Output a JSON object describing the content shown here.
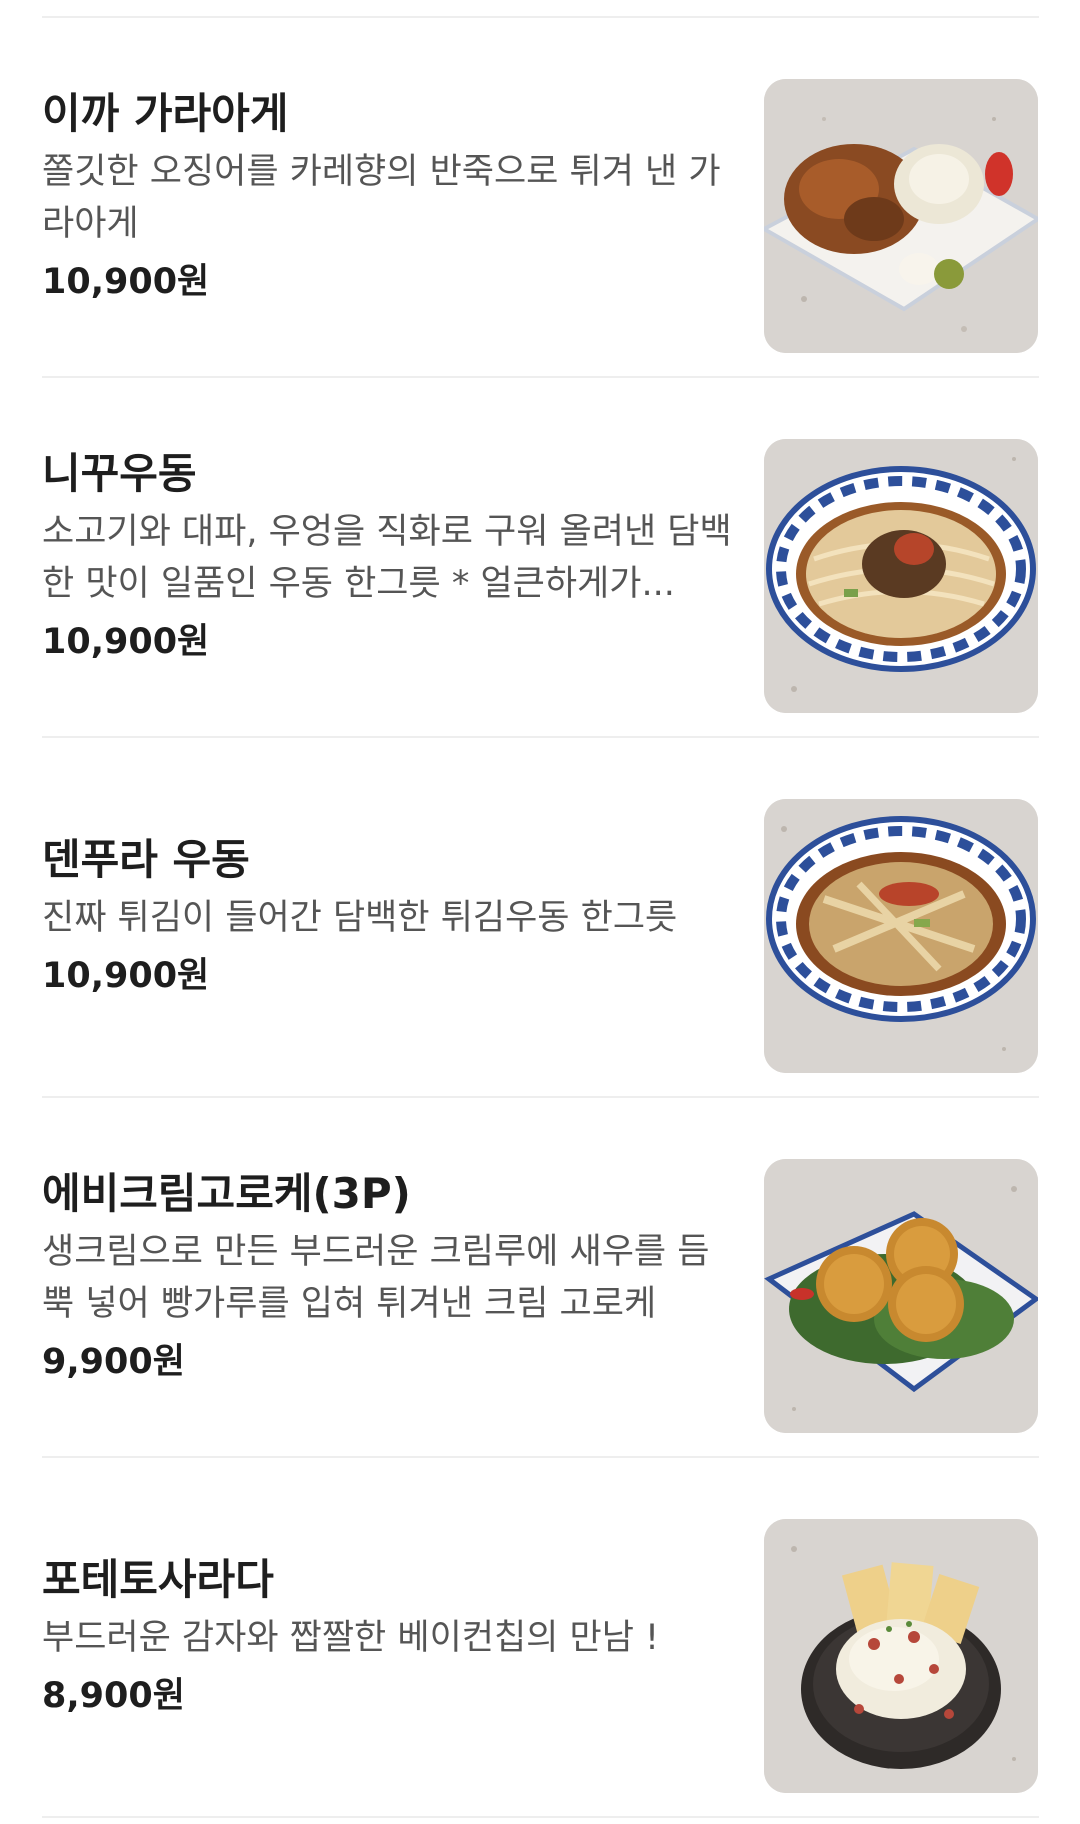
{
  "menu": {
    "items": [
      {
        "name": "이까 가라아게",
        "description": "쫄깃한 오징어를 카레향의 반죽으로 튀겨 낸 가라아게",
        "price": "10,900원",
        "image": "squid-karaage-plate-photo"
      },
      {
        "name": "니꾸우동",
        "description": "소고기와 대파, 우엉을 직화로 구워 올려낸 담백한 맛이 일품인 우동 한그릇 * 얼큰하게가...",
        "price": "10,900원",
        "image": "beef-udon-bowl-photo"
      },
      {
        "name": "덴푸라 우동",
        "description": "진짜 튀김이 들어간 담백한 튀김우동 한그릇",
        "price": "10,900원",
        "image": "tempura-udon-bowl-photo"
      },
      {
        "name": "에비크림고로케(3P)",
        "description": "생크림으로 만든 부드러운 크림루에 새우를 듬뿍 넣어 빵가루를 입혀 튀겨낸 크림 고로케",
        "price": "9,900원",
        "image": "shrimp-cream-croquette-photo"
      },
      {
        "name": "포테토사라다",
        "description": "부드러운 감자와 짭짤한 베이컨칩의 만남 !",
        "price": "8,900원",
        "image": "potato-salad-photo"
      }
    ]
  }
}
